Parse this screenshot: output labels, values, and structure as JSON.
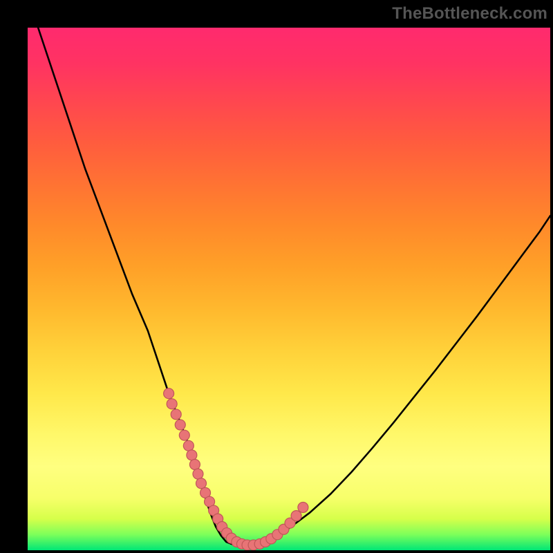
{
  "watermark": "TheBottleneck.com",
  "colors": {
    "background_frame": "#000000",
    "gradient_stops": [
      "#00e676",
      "#ffff80",
      "#ff8a2a",
      "#ff2a6e"
    ],
    "curve_stroke": "#000000",
    "dot_fill": "#e87476",
    "dot_stroke": "#c05658"
  },
  "chart_data": {
    "type": "line",
    "title": "",
    "xlabel": "",
    "ylabel": "",
    "xlim": [
      0,
      100
    ],
    "ylim": [
      0,
      100
    ],
    "grid": false,
    "legend": null,
    "series": [
      {
        "name": "bottleneck-curve",
        "x": [
          2,
          5,
          8,
          11,
          14,
          17,
          20,
          23,
          25,
          27,
          29,
          30.5,
          32,
          33,
          34,
          35,
          36,
          37,
          38,
          39.5,
          41.5,
          44,
          47,
          50,
          54,
          58,
          62,
          66,
          70,
          74,
          78,
          82,
          86,
          90,
          94,
          98,
          100
        ],
        "y": [
          100,
          91,
          82,
          73,
          65,
          57,
          49,
          42,
          36,
          30,
          25,
          21,
          17,
          13,
          10,
          7,
          4.5,
          2.8,
          1.6,
          1.0,
          1.0,
          1.2,
          2.3,
          4.2,
          7.2,
          10.8,
          15.0,
          19.6,
          24.4,
          29.4,
          34.4,
          39.6,
          44.8,
          50.2,
          55.6,
          61.0,
          64.0
        ]
      }
    ],
    "highlight_points": {
      "name": "data-dots",
      "x": [
        27.0,
        27.6,
        28.4,
        29.2,
        30.0,
        30.8,
        31.4,
        32.0,
        32.6,
        33.2,
        34.0,
        34.8,
        35.6,
        36.4,
        37.2,
        38.1,
        39.0,
        40.0,
        41.0,
        42.0,
        43.2,
        44.4,
        45.5,
        46.6,
        47.8,
        49.0,
        50.2,
        51.4,
        52.7
      ],
      "y": [
        30.0,
        28.0,
        26.0,
        24.0,
        22.0,
        20.0,
        18.2,
        16.4,
        14.6,
        12.8,
        11.0,
        9.3,
        7.6,
        6.0,
        4.5,
        3.3,
        2.3,
        1.6,
        1.2,
        1.0,
        1.0,
        1.2,
        1.6,
        2.2,
        3.0,
        4.0,
        5.2,
        6.6,
        8.2
      ]
    }
  }
}
